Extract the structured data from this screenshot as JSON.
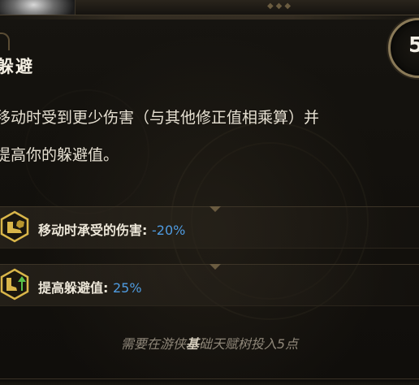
{
  "skill": {
    "title": "躲避",
    "rank": "5",
    "description_lines": [
      "移动时受到更少伤害（与其他修正值相乘算）并",
      "提高你的躲避值。"
    ]
  },
  "stats": [
    {
      "label": "移动时承受的伤害:",
      "value": "-20%",
      "icon": "boot-shield-icon"
    },
    {
      "label": "提高躲避值:",
      "value": "25%",
      "icon": "boot-arrow-up-icon"
    }
  ],
  "requirement": {
    "prefix": "需要在游侠",
    "highlight": "基",
    "suffix": "础天赋树投入5点"
  },
  "colors": {
    "value_blue": "#4f9be0",
    "gold_frame": "#8a7a58",
    "icon_gold": "#d9b64a"
  }
}
